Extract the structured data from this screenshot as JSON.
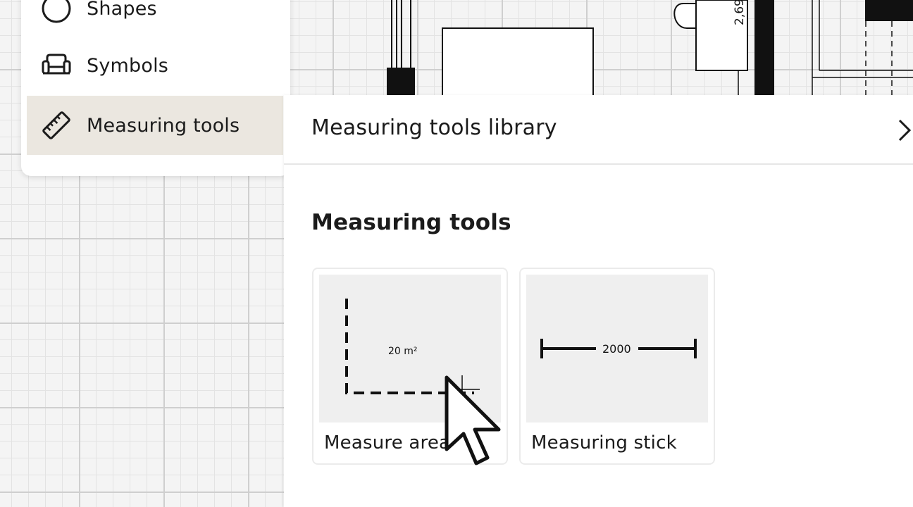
{
  "menu": {
    "items": [
      {
        "label": "Shapes",
        "icon": "circle-icon",
        "active": false
      },
      {
        "label": "Symbols",
        "icon": "sofa-icon",
        "active": false
      },
      {
        "label": "Measuring tools",
        "icon": "ruler-icon",
        "active": true
      }
    ]
  },
  "plan": {
    "dimension_label": "2,69"
  },
  "library": {
    "title": "Measuring tools library",
    "section_title": "Measuring tools",
    "cards": [
      {
        "label": "Measure area",
        "preview_text": "20 m²",
        "icon": "measure-area-icon"
      },
      {
        "label": "Measuring stick",
        "preview_text": "2000",
        "icon": "measuring-stick-icon"
      }
    ]
  },
  "colors": {
    "active_menu_bg": "#ebe7e0",
    "panel_bg": "#ffffff",
    "card_thumb_bg": "#efefef",
    "text": "#1b1b1b"
  }
}
